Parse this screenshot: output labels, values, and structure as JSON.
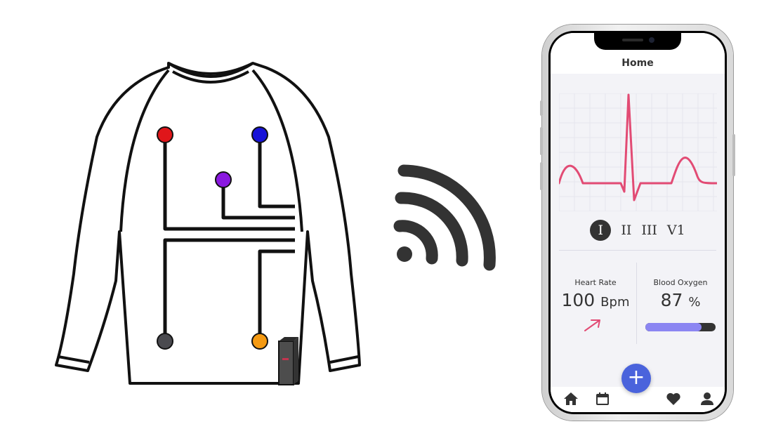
{
  "phone": {
    "title": "Home",
    "leads": [
      "I",
      "II",
      "III",
      "V1"
    ],
    "heart_rate": {
      "label": "Heart Rate",
      "value": "100",
      "unit": "Bpm"
    },
    "blood_oxygen": {
      "label": "Blood Oxygen",
      "value": "87",
      "unit": "%",
      "level_percent": 80
    },
    "colors": {
      "ecg": "#e24b74",
      "accent": "#4a63dc",
      "progress": "#8b85f2"
    }
  },
  "shirt": {
    "electrode_colors": [
      "#e0161a",
      "#1713d8",
      "#8a18e0",
      "#4a4a4f",
      "#f59a12"
    ]
  }
}
